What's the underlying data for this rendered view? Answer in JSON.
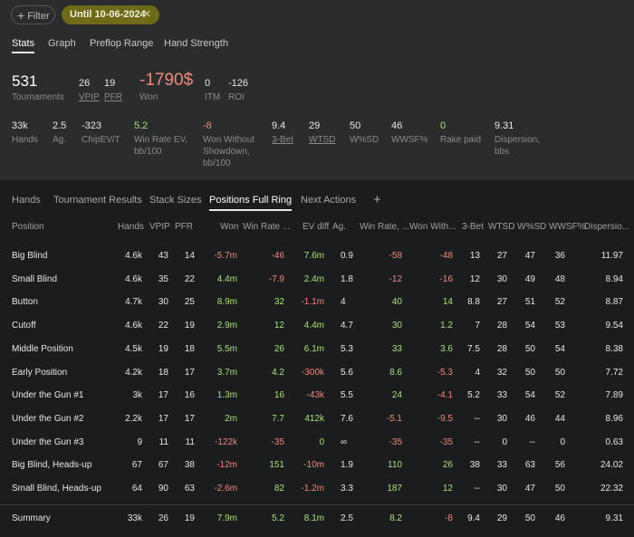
{
  "filter_label": "Filter",
  "date_chip": "Until 10-06-2024",
  "top_tabs": [
    "Stats",
    "Graph",
    "Preflop Range",
    "Hand Strength"
  ],
  "row1": {
    "tournaments": {
      "value": "531",
      "label": "Tournaments"
    },
    "vpip": {
      "value": "26",
      "label": "VPIP"
    },
    "pfr": {
      "value": "19",
      "label": "PFR"
    },
    "won": {
      "value": "-1790$",
      "label": "Won"
    },
    "itm": {
      "value": "0",
      "label": "ITM"
    },
    "roi": {
      "value": "-126",
      "label": "ROI"
    }
  },
  "row2": [
    {
      "value": "33k",
      "label": "Hands"
    },
    {
      "value": "2.5",
      "label": "Ag."
    },
    {
      "value": "-323",
      "label": "ChipEV/T"
    },
    {
      "value": "5.2",
      "label": "Win Rate EV, bb/100"
    },
    {
      "value": "-8",
      "label": "Won Without Showdown, bb/100"
    },
    {
      "value": "9.4",
      "label": "3-Bet"
    },
    {
      "value": "29",
      "label": "WTSD"
    },
    {
      "value": "50",
      "label": "W%SD"
    },
    {
      "value": "46",
      "label": "WWSF%"
    },
    {
      "value": "0",
      "label": "Rake paid"
    },
    {
      "value": "9.31",
      "label": "Dispersion, bbs"
    }
  ],
  "section_tabs": [
    "Hands",
    "Tournament Results",
    "Stack Sizes",
    "Positions Full Ring",
    "Next Actions",
    "+"
  ],
  "columns": [
    "Position",
    "Hands",
    "VPIP",
    "PFR",
    "Won",
    "Win Rate ...",
    "EV diff",
    "Ag.",
    "Win Rate, ...",
    "Won With...",
    "3-Bet",
    "WTSD",
    "W%SD",
    "WWSF%",
    "Dispersio..."
  ],
  "rows": [
    [
      "Big Blind",
      "4.6k",
      "43",
      "14",
      "-5.7m",
      "-46",
      "7.6m",
      "0.9",
      "-58",
      "-48",
      "13",
      "27",
      "47",
      "36",
      "11.97"
    ],
    [
      "Small Blind",
      "4.6k",
      "35",
      "22",
      "4.4m",
      "-7.9",
      "2.4m",
      "1.8",
      "-12",
      "-16",
      "12",
      "30",
      "49",
      "48",
      "8.94"
    ],
    [
      "Button",
      "4.7k",
      "30",
      "25",
      "8.9m",
      "32",
      "-1.1m",
      "4",
      "40",
      "14",
      "8.8",
      "27",
      "51",
      "52",
      "8.87"
    ],
    [
      "Cutoff",
      "4.6k",
      "22",
      "19",
      "2.9m",
      "12",
      "4.4m",
      "4.7",
      "30",
      "1.2",
      "7",
      "28",
      "54",
      "53",
      "9.54"
    ],
    [
      "Middle Position",
      "4.5k",
      "19",
      "18",
      "5.5m",
      "26",
      "6.1m",
      "5.3",
      "33",
      "3.6",
      "7.5",
      "28",
      "50",
      "54",
      "8.38"
    ],
    [
      "Early Position",
      "4.2k",
      "18",
      "17",
      "3.7m",
      "4.2",
      "-300k",
      "5.6",
      "8.6",
      "-5.3",
      "4",
      "32",
      "50",
      "50",
      "7.72"
    ],
    [
      "Under the Gun #1",
      "3k",
      "17",
      "16",
      "1.3m",
      "16",
      "-43k",
      "5.5",
      "24",
      "-4.1",
      "5.2",
      "33",
      "54",
      "52",
      "7.89"
    ],
    [
      "Under the Gun #2",
      "2.2k",
      "17",
      "17",
      "2m",
      "7.7",
      "412k",
      "7.6",
      "-5.1",
      "-9.5",
      "--",
      "30",
      "46",
      "44",
      "8.96"
    ],
    [
      "Under the Gun #3",
      "9",
      "11",
      "11",
      "-122k",
      "-35",
      "0",
      "∞",
      "-35",
      "-35",
      "--",
      "0",
      "--",
      "0",
      "0.63"
    ],
    [
      "Big Blind, Heads-up",
      "67",
      "67",
      "38",
      "-12m",
      "151",
      "-10m",
      "1.9",
      "110",
      "26",
      "38",
      "33",
      "63",
      "56",
      "24.02"
    ],
    [
      "Small Blind, Heads-up",
      "64",
      "90",
      "63",
      "-2.6m",
      "82",
      "-1.2m",
      "3.3",
      "187",
      "12",
      "--",
      "30",
      "47",
      "50",
      "22.32"
    ]
  ],
  "summary": [
    "Summary",
    "33k",
    "26",
    "19",
    "7.9m",
    "5.2",
    "8.1m",
    "2.5",
    "8.2",
    "-8",
    "9.4",
    "29",
    "50",
    "46",
    "9.31"
  ],
  "colors": {
    "positive": "#a9e07a",
    "negative": "#f08a7a",
    "accent_chip": "#6d6b17"
  }
}
